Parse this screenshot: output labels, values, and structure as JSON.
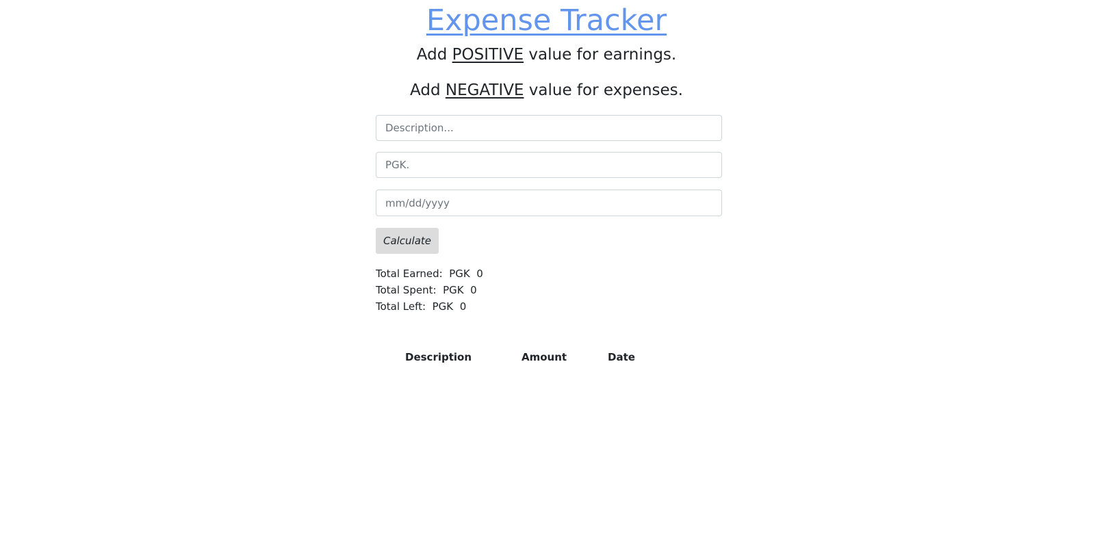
{
  "header": {
    "title": "Expense Tracker"
  },
  "hints": {
    "positive": {
      "prefix": "Add ",
      "keyword": "POSITIVE",
      "suffix": " value for earnings."
    },
    "negative": {
      "prefix": "Add ",
      "keyword": "NEGATIVE",
      "suffix": " value for expenses."
    }
  },
  "form": {
    "description_placeholder": "Description...",
    "description_value": "",
    "amount_placeholder": "PGK.",
    "amount_value": "",
    "date_placeholder": "mm/dd/yyyy",
    "date_value": "",
    "calculate_label": "Calculate"
  },
  "totals": {
    "earned_label": "Total Earned:",
    "spent_label": "Total Spent:",
    "left_label": "Total Left:",
    "currency": "PGK",
    "earned_value": "0",
    "spent_value": "0",
    "left_value": "0"
  },
  "table": {
    "columns": [
      "Description",
      "Amount",
      "Date"
    ],
    "rows": []
  },
  "colors": {
    "title": "#6495ed",
    "button_bg": "#dcdcdc",
    "input_border": "#ced4da"
  }
}
